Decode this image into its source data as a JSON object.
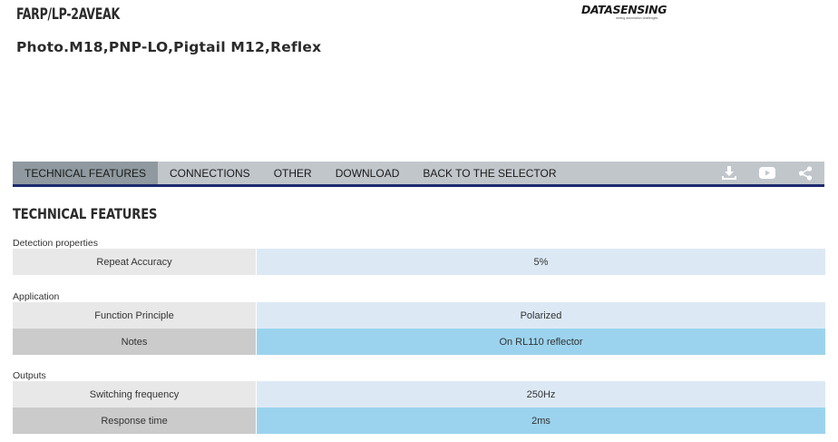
{
  "product": {
    "code": "FARP/LP-2AVEAK",
    "description": "Photo.M18,PNP-LO,Pigtail M12,Reflex"
  },
  "logo": {
    "text": "DATASENSING",
    "tagline": "seeing automation challenges"
  },
  "tabs": [
    {
      "label": "TECHNICAL FEATURES",
      "active": true
    },
    {
      "label": "CONNECTIONS",
      "active": false
    },
    {
      "label": "OTHER",
      "active": false
    },
    {
      "label": "DOWNLOAD",
      "active": false
    },
    {
      "label": "BACK TO THE SELECTOR",
      "active": false
    }
  ],
  "tab_icons": [
    "download-icon",
    "youtube-icon",
    "share-icon"
  ],
  "section_title": "TECHNICAL FEATURES",
  "groups": [
    {
      "label": "Detection properties",
      "rows": [
        {
          "key": "Repeat Accuracy",
          "value": "5%"
        }
      ]
    },
    {
      "label": "Application",
      "rows": [
        {
          "key": "Function Principle",
          "value": "Polarized"
        },
        {
          "key": "Notes",
          "value": "On RL110 reflector"
        }
      ]
    },
    {
      "label": "Outputs",
      "rows": [
        {
          "key": "Switching frequency",
          "value": "250Hz"
        },
        {
          "key": "Response time",
          "value": "2ms"
        }
      ]
    }
  ],
  "colors": {
    "tabbar": "#c1c6cb",
    "tab_active": "#8f999f",
    "tab_underline": "#1c2a6e",
    "row_key_light": "#e8e8e8",
    "row_val_light": "#dce9f5",
    "row_key_dark": "#cbcbcb",
    "row_val_dark": "#9bd3ee"
  }
}
